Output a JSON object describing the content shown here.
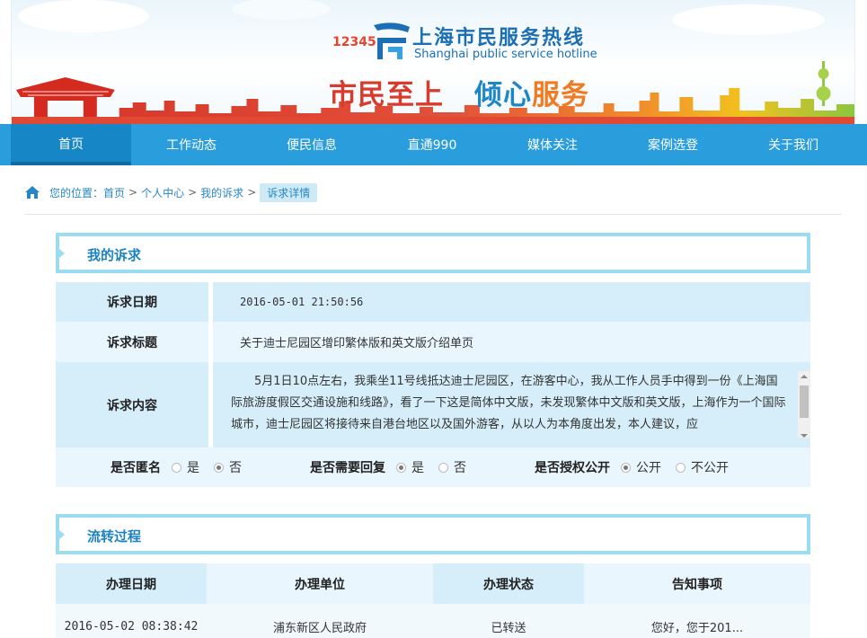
{
  "colors": {
    "nav_bg": "#2a9ddd",
    "nav_active": "#1686c6",
    "accent": "#1b83c3",
    "section_border": "#9cdcf2",
    "slogan_red": "#d83a2b",
    "slogan_blue": "#1d86c9",
    "slogan_orange": "#ef7b22"
  },
  "header": {
    "logo_digits": "12345",
    "title_cn": "上海市民服务热线",
    "title_en": "Shanghai public service hotline",
    "slogan_a": "市民至上",
    "slogan_b1": "倾心",
    "slogan_b2": "服务"
  },
  "nav": [
    {
      "label": "首页"
    },
    {
      "label": "工作动态"
    },
    {
      "label": "便民信息"
    },
    {
      "label": "直通990"
    },
    {
      "label": "媒体关注"
    },
    {
      "label": "案例选登"
    },
    {
      "label": "关于我们"
    }
  ],
  "breadcrumb": {
    "prefix": "您的位置：",
    "items": [
      "首页",
      "个人中心",
      "我的诉求"
    ],
    "separator": ">",
    "current": "诉求详情"
  },
  "appeal": {
    "section_title": "我的诉求",
    "date_label": "诉求日期",
    "date_value": "2016-05-01 21:50:56",
    "subject_label": "诉求标题",
    "subject_value": "关于迪士尼园区增印繁体版和英文版介绍单页",
    "content_label": "诉求内容",
    "content_value": "5月1日10点左右，我乘坐11号线抵达迪士尼园区，在游客中心，我从工作人员手中得到一份《上海国际旅游度假区交通设施和线路》，看了一下这是简体中文版，未发现繁体中文版和英文版，上海作为一个国际城市，迪士尼园区将接待来自港台地区以及国外游客，从以人为本角度出发，本人建议，应",
    "anonymous_label": "是否匿名",
    "anonymous_yes": "是",
    "anonymous_no": "否",
    "reply_label": "是否需要回复",
    "reply_yes": "是",
    "reply_no": "否",
    "public_label": "是否授权公开",
    "public_yes": "公开",
    "public_no": "不公开"
  },
  "flow": {
    "section_title": "流转过程",
    "headers": [
      "办理日期",
      "办理单位",
      "办理状态",
      "告知事项"
    ],
    "rows": [
      [
        "2016-05-02 08:38:42",
        "浦东新区人民政府",
        "已转送",
        "您好，您于201..."
      ]
    ]
  }
}
